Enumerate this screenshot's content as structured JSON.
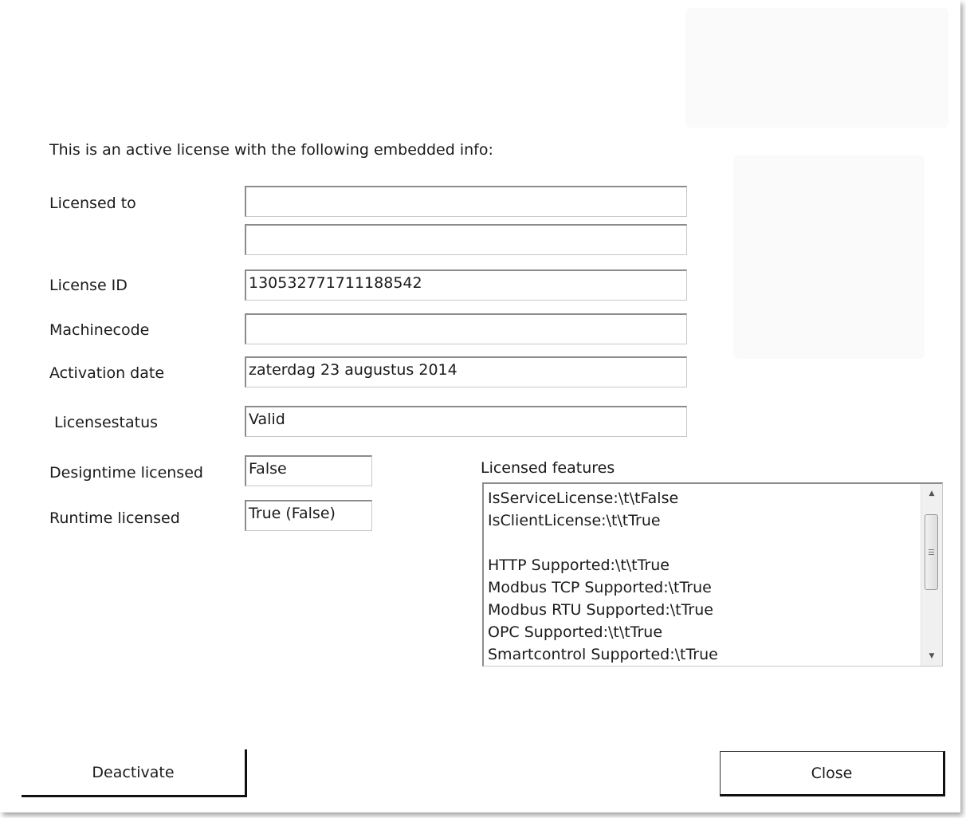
{
  "intro_text": "This is an active license with the following embedded info:",
  "fields": {
    "licensed_to": {
      "label": "Licensed to",
      "value_line1": "",
      "value_line2": ""
    },
    "license_id": {
      "label": "License ID",
      "value": "130532771711188542"
    },
    "machinecode": {
      "label": "Machinecode",
      "value": ""
    },
    "activation_date": {
      "label": "Activation date",
      "value": "zaterdag 23 augustus 2014"
    },
    "licensestatus": {
      "label": "Licensestatus",
      "value": "Valid"
    },
    "designtime_licensed": {
      "label": "Designtime licensed",
      "value": "False"
    },
    "runtime_licensed": {
      "label": "Runtime licensed",
      "value": "True (False)"
    }
  },
  "licensed_features": {
    "label": "Licensed features",
    "items": [
      "IsServiceLicense:\\t\\tFalse",
      "IsClientLicense:\\t\\tTrue",
      "",
      "HTTP Supported:\\t\\tTrue",
      "Modbus TCP Supported:\\tTrue",
      "Modbus RTU Supported:\\tTrue",
      "OPC Supported:\\t\\tTrue",
      "Smartcontrol Supported:\\tTrue"
    ]
  },
  "buttons": {
    "deactivate": "Deactivate",
    "close": "Close"
  },
  "icons": {
    "scroll_up": "scroll-up-arrow-icon",
    "scroll_down": "scroll-down-arrow-icon",
    "scroll_grip": "scroll-grip-icon"
  }
}
